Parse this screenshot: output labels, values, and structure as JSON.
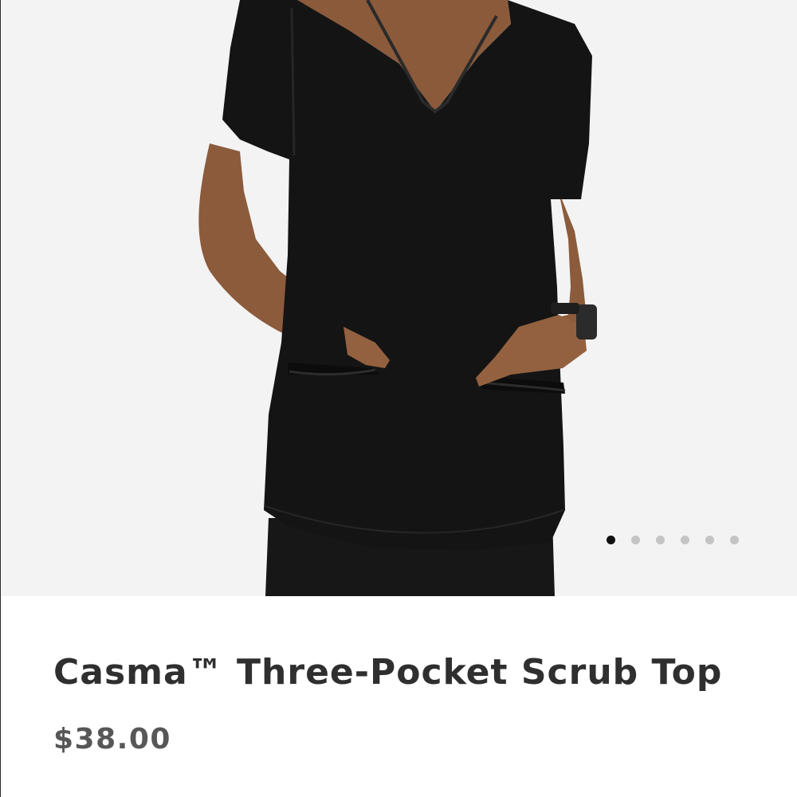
{
  "product": {
    "title": "Casma™ Three-Pocket Scrub Top",
    "price": "$38.00"
  },
  "gallery": {
    "image_count": 6,
    "active_index": 0,
    "dot_colors": {
      "active": "#111111",
      "inactive": "#c4c4c4"
    },
    "background_color": "#f3f3f3",
    "garment_color": "#141414"
  }
}
